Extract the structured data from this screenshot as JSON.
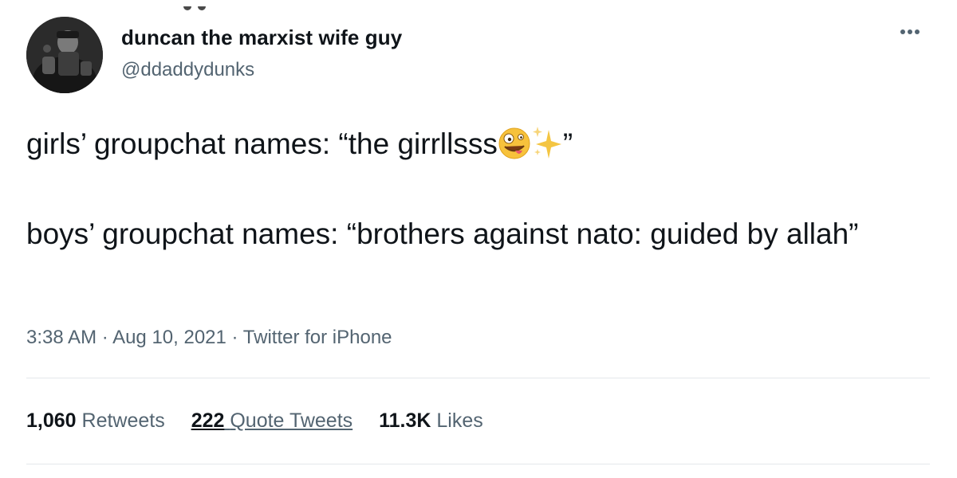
{
  "user": {
    "display_name": "duncan the marxist wife guy",
    "handle": "@ddaddydunks"
  },
  "tweet": {
    "line1_text": "girls’ groupchat names: “the girrllsss",
    "line1_close_quote": "”",
    "line1_emojis": [
      "zany-face-emoji",
      "sparkles-emoji"
    ],
    "line2_text": "boys’ groupchat names: “brothers against nato: guided by allah”"
  },
  "meta": {
    "time": "3:38 AM",
    "separator": " · ",
    "date": "Aug 10, 2021",
    "source": "Twitter for iPhone"
  },
  "stats": {
    "retweets_count": "1,060",
    "retweets_label": "Retweets",
    "quotes_count": "222",
    "quotes_label": "Quote Tweets",
    "likes_count": "11.3K",
    "likes_label": "Likes"
  },
  "icons": {
    "more": "more-horizontal-icon",
    "avatar": "profile-avatar"
  },
  "colors": {
    "text_primary": "#0f1419",
    "text_secondary": "#536471",
    "divider": "#e4e8eb"
  }
}
